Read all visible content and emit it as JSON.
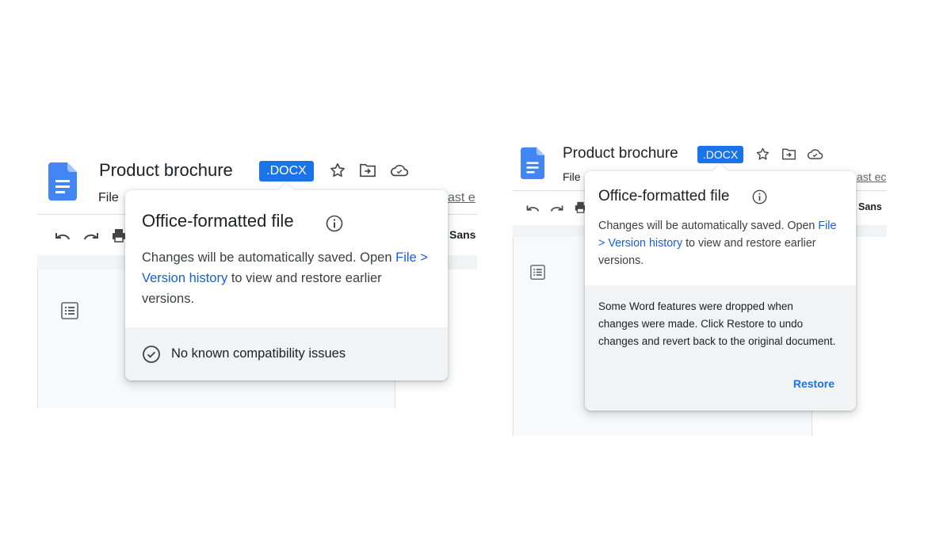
{
  "colors": {
    "accent": "#1a73e8",
    "link": "#1a5ed8",
    "footer_bg": "#f1f3f4",
    "doc_icon": "#4285f4"
  },
  "left": {
    "document_title": "Product brochure",
    "format_badge": ".DOCX",
    "menu_file": "File",
    "last_edit": "ast e",
    "font_name": "Sans",
    "popover": {
      "title": "Office-formatted file",
      "body_before": "Changes will be automatically saved. Open",
      "link": "File > Version history",
      "body_after": "to view and restore earlier versions.",
      "compatibility": "No known compatibility issues"
    }
  },
  "right": {
    "document_title": "Product brochure",
    "format_badge": ".DOCX",
    "menu_file": "File",
    "last_edit": "ast ec",
    "font_name": "Sans",
    "popover": {
      "title": "Office-formatted file",
      "body_before": "Changes will be automatically saved. Open",
      "link": "File > Version history",
      "body_after": "to view and restore earlier versions.",
      "warning": "Some Word features were dropped when changes were made. Click Restore to undo changes and revert back to the original document.",
      "restore_label": "Restore"
    }
  },
  "icons": [
    "docs-icon",
    "star-icon",
    "move-to-folder-icon",
    "cloud-status-icon",
    "undo-icon",
    "redo-icon",
    "print-icon",
    "outline-icon",
    "info-icon",
    "check-circle-icon"
  ]
}
